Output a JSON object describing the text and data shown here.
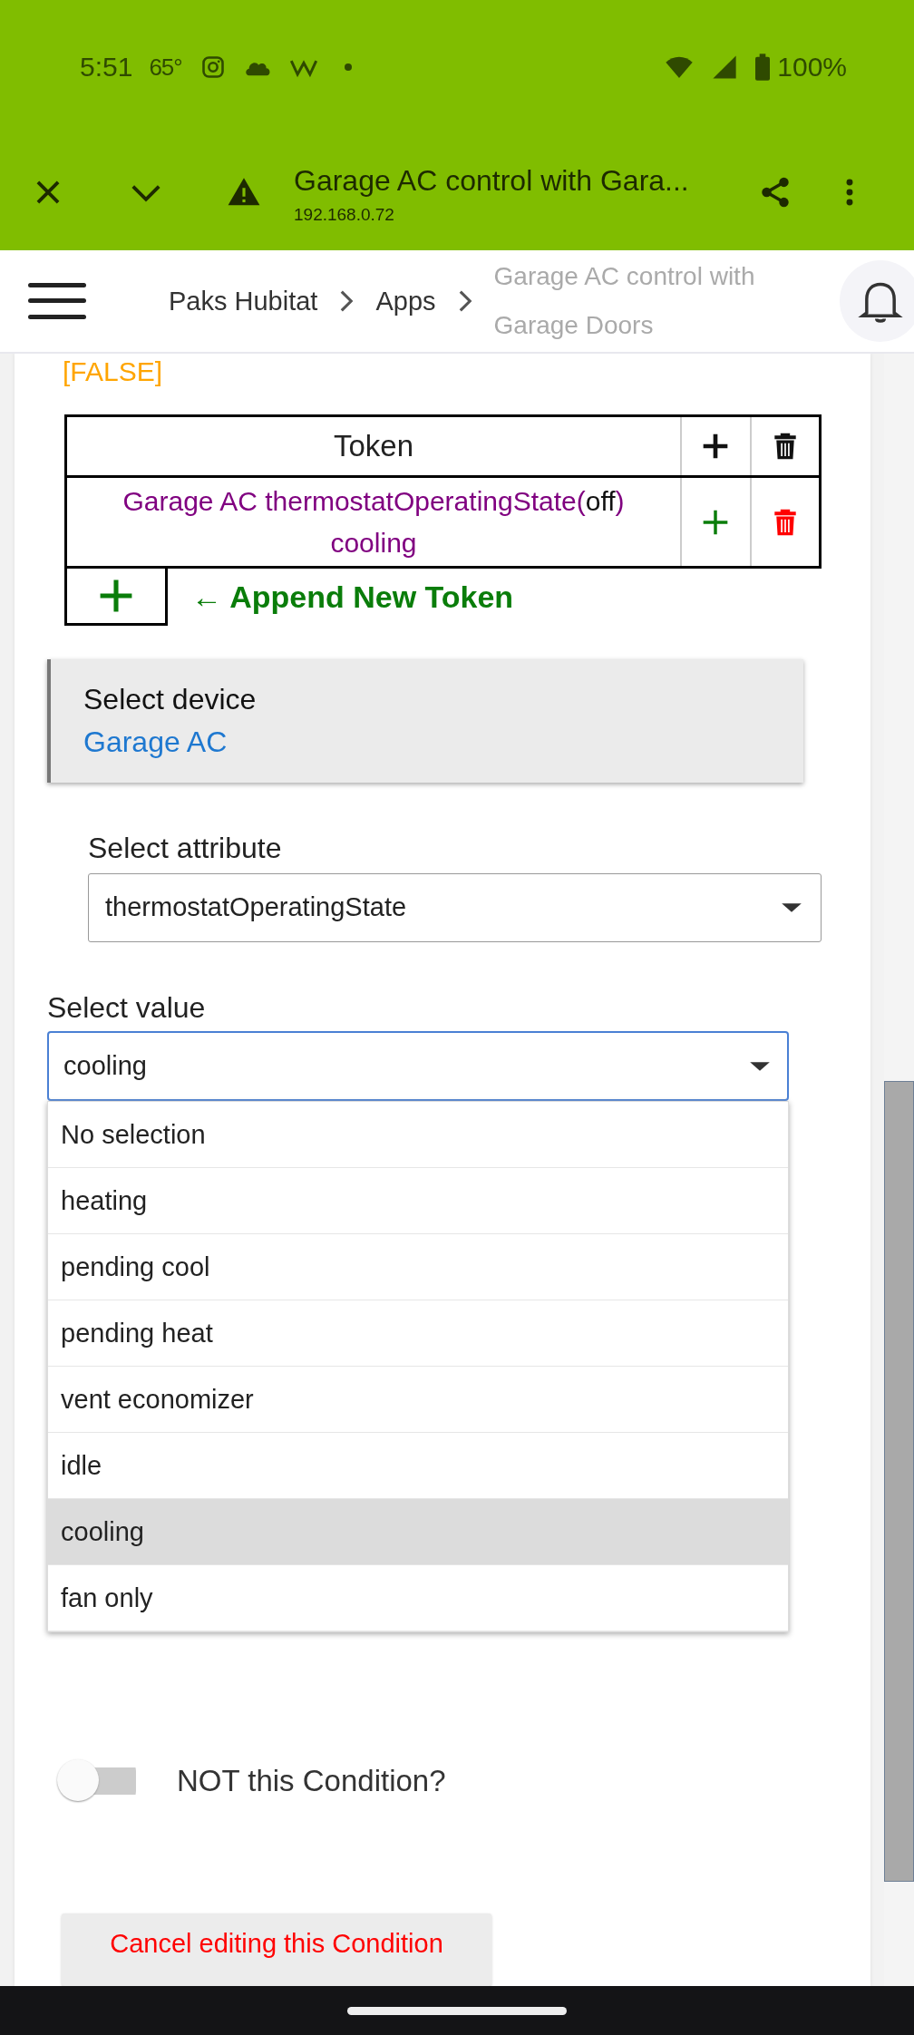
{
  "status_bar": {
    "time": "5:51",
    "temperature": "65°",
    "battery": "100%"
  },
  "browser_bar": {
    "title": "Garage AC control with Gara...",
    "url": "192.168.0.72"
  },
  "breadcrumbs": [
    {
      "label": "Paks Hubitat",
      "current": false
    },
    {
      "label": "Apps",
      "current": false
    },
    {
      "label": "Garage AC control with Garage Doors",
      "current": true
    }
  ],
  "result": "[FALSE]",
  "token_table": {
    "header": "Token",
    "rows": [
      {
        "before": "Garage AC thermostatOperatingState(",
        "value": "off",
        "after": ") cooling"
      }
    ],
    "append_label": "← Append New Token"
  },
  "device": {
    "label": "Select device",
    "value": "Garage AC"
  },
  "attribute": {
    "label": "Select attribute",
    "value": "thermostatOperatingState"
  },
  "value_select": {
    "label": "Select value",
    "value": "cooling",
    "options": [
      {
        "label": "No selection",
        "selected": false
      },
      {
        "label": "heating",
        "selected": false
      },
      {
        "label": "pending cool",
        "selected": false
      },
      {
        "label": "pending heat",
        "selected": false
      },
      {
        "label": "vent economizer",
        "selected": false
      },
      {
        "label": "idle",
        "selected": false
      },
      {
        "label": "cooling",
        "selected": true
      },
      {
        "label": "fan only",
        "selected": false
      }
    ]
  },
  "not_toggle": {
    "label": "NOT this Condition?",
    "on": false
  },
  "cancel_button": "Cancel editing this Condition"
}
